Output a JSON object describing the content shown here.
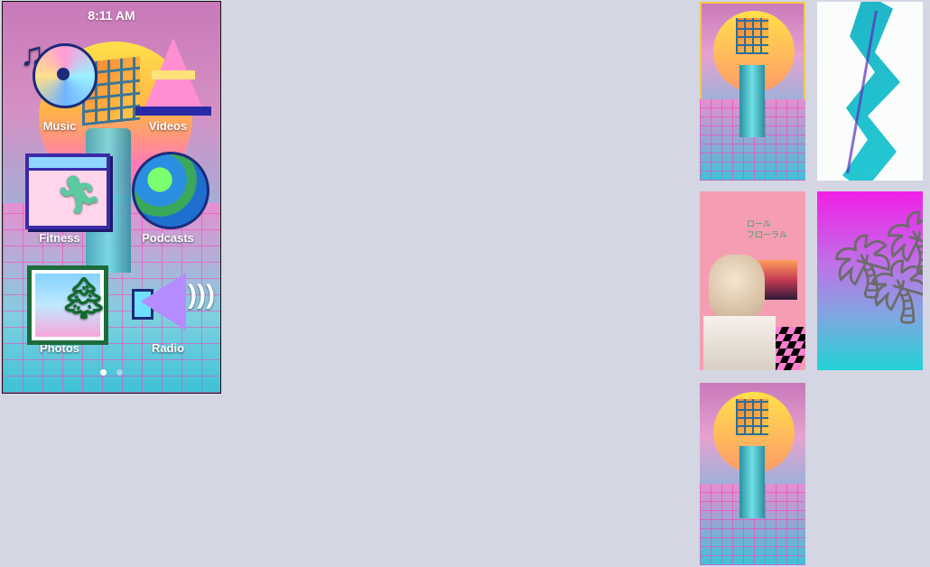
{
  "status_bar": {
    "time": "8:11 AM"
  },
  "home_screen": {
    "apps": [
      {
        "label": "Music",
        "icon": "music-cd-icon"
      },
      {
        "label": "Videos",
        "icon": "traffic-cone-icon"
      },
      {
        "label": "Fitness",
        "icon": "runner-window-icon"
      },
      {
        "label": "Podcasts",
        "icon": "globe-icon"
      },
      {
        "label": "Photos",
        "icon": "picture-frame-icon"
      },
      {
        "label": "Radio",
        "icon": "speaker-icon"
      }
    ],
    "page_indicator": {
      "pages": 2,
      "current": 1
    }
  },
  "wallpapers": [
    {
      "name": "vaporwave-column-sun",
      "selected": true
    },
    {
      "name": "jazz-cup-squiggle",
      "selected": false
    },
    {
      "name": "floral-shoppe-bust",
      "selected": false
    },
    {
      "name": "magenta-palm-trees",
      "selected": false
    },
    {
      "name": "vaporwave-column-sun",
      "selected": false
    }
  ],
  "colors": {
    "background": "#d4d6e3",
    "selection_outline": "#f2c94c",
    "dot_active": "#ffffff",
    "dot_inactive": "#9fd9ea"
  },
  "wallpaper_text": {
    "floral_sign_line1": "ロール",
    "floral_sign_line2": "フローラル"
  }
}
